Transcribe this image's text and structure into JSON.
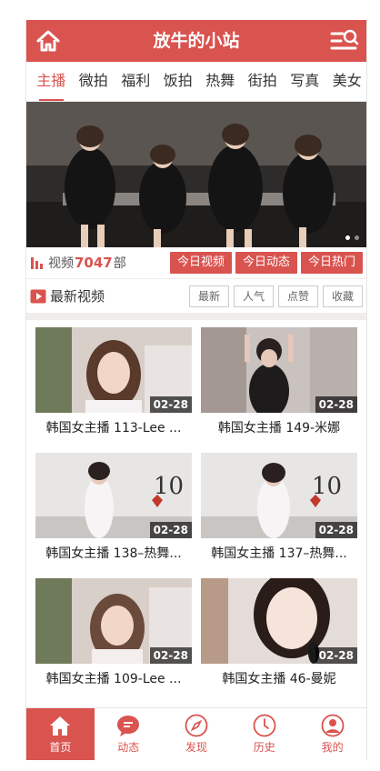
{
  "header": {
    "title": "放牛的小站"
  },
  "tabs": [
    "主播",
    "微拍",
    "福利",
    "饭拍",
    "热舞",
    "街拍",
    "写真",
    "美女"
  ],
  "active_tab": 0,
  "stats": {
    "label": "视频",
    "count": "7047",
    "unit": "部"
  },
  "today_buttons": [
    "今日视频",
    "今日动态",
    "今日热门"
  ],
  "section": {
    "title": "最新视频"
  },
  "sort_buttons": [
    "最新",
    "人气",
    "点赞",
    "收藏"
  ],
  "videos": [
    {
      "title": "韩国女主播 113-Lee ...",
      "date": "02-28"
    },
    {
      "title": "韩国女主播 149-米娜",
      "date": "02-28"
    },
    {
      "title": "韩国女主播 138–热舞...",
      "date": "02-28"
    },
    {
      "title": "韩国女主播 137–热舞...",
      "date": "02-28"
    },
    {
      "title": "韩国女主播 109-Lee ...",
      "date": "02-28"
    },
    {
      "title": "韩国女主播 46-曼妮",
      "date": "02-28"
    }
  ],
  "footer": [
    "首页",
    "动态",
    "发现",
    "历史",
    "我的"
  ],
  "colors": {
    "accent": "#d9534f",
    "tab_border": "#e5e5e5",
    "divider": "#f0eeec"
  }
}
